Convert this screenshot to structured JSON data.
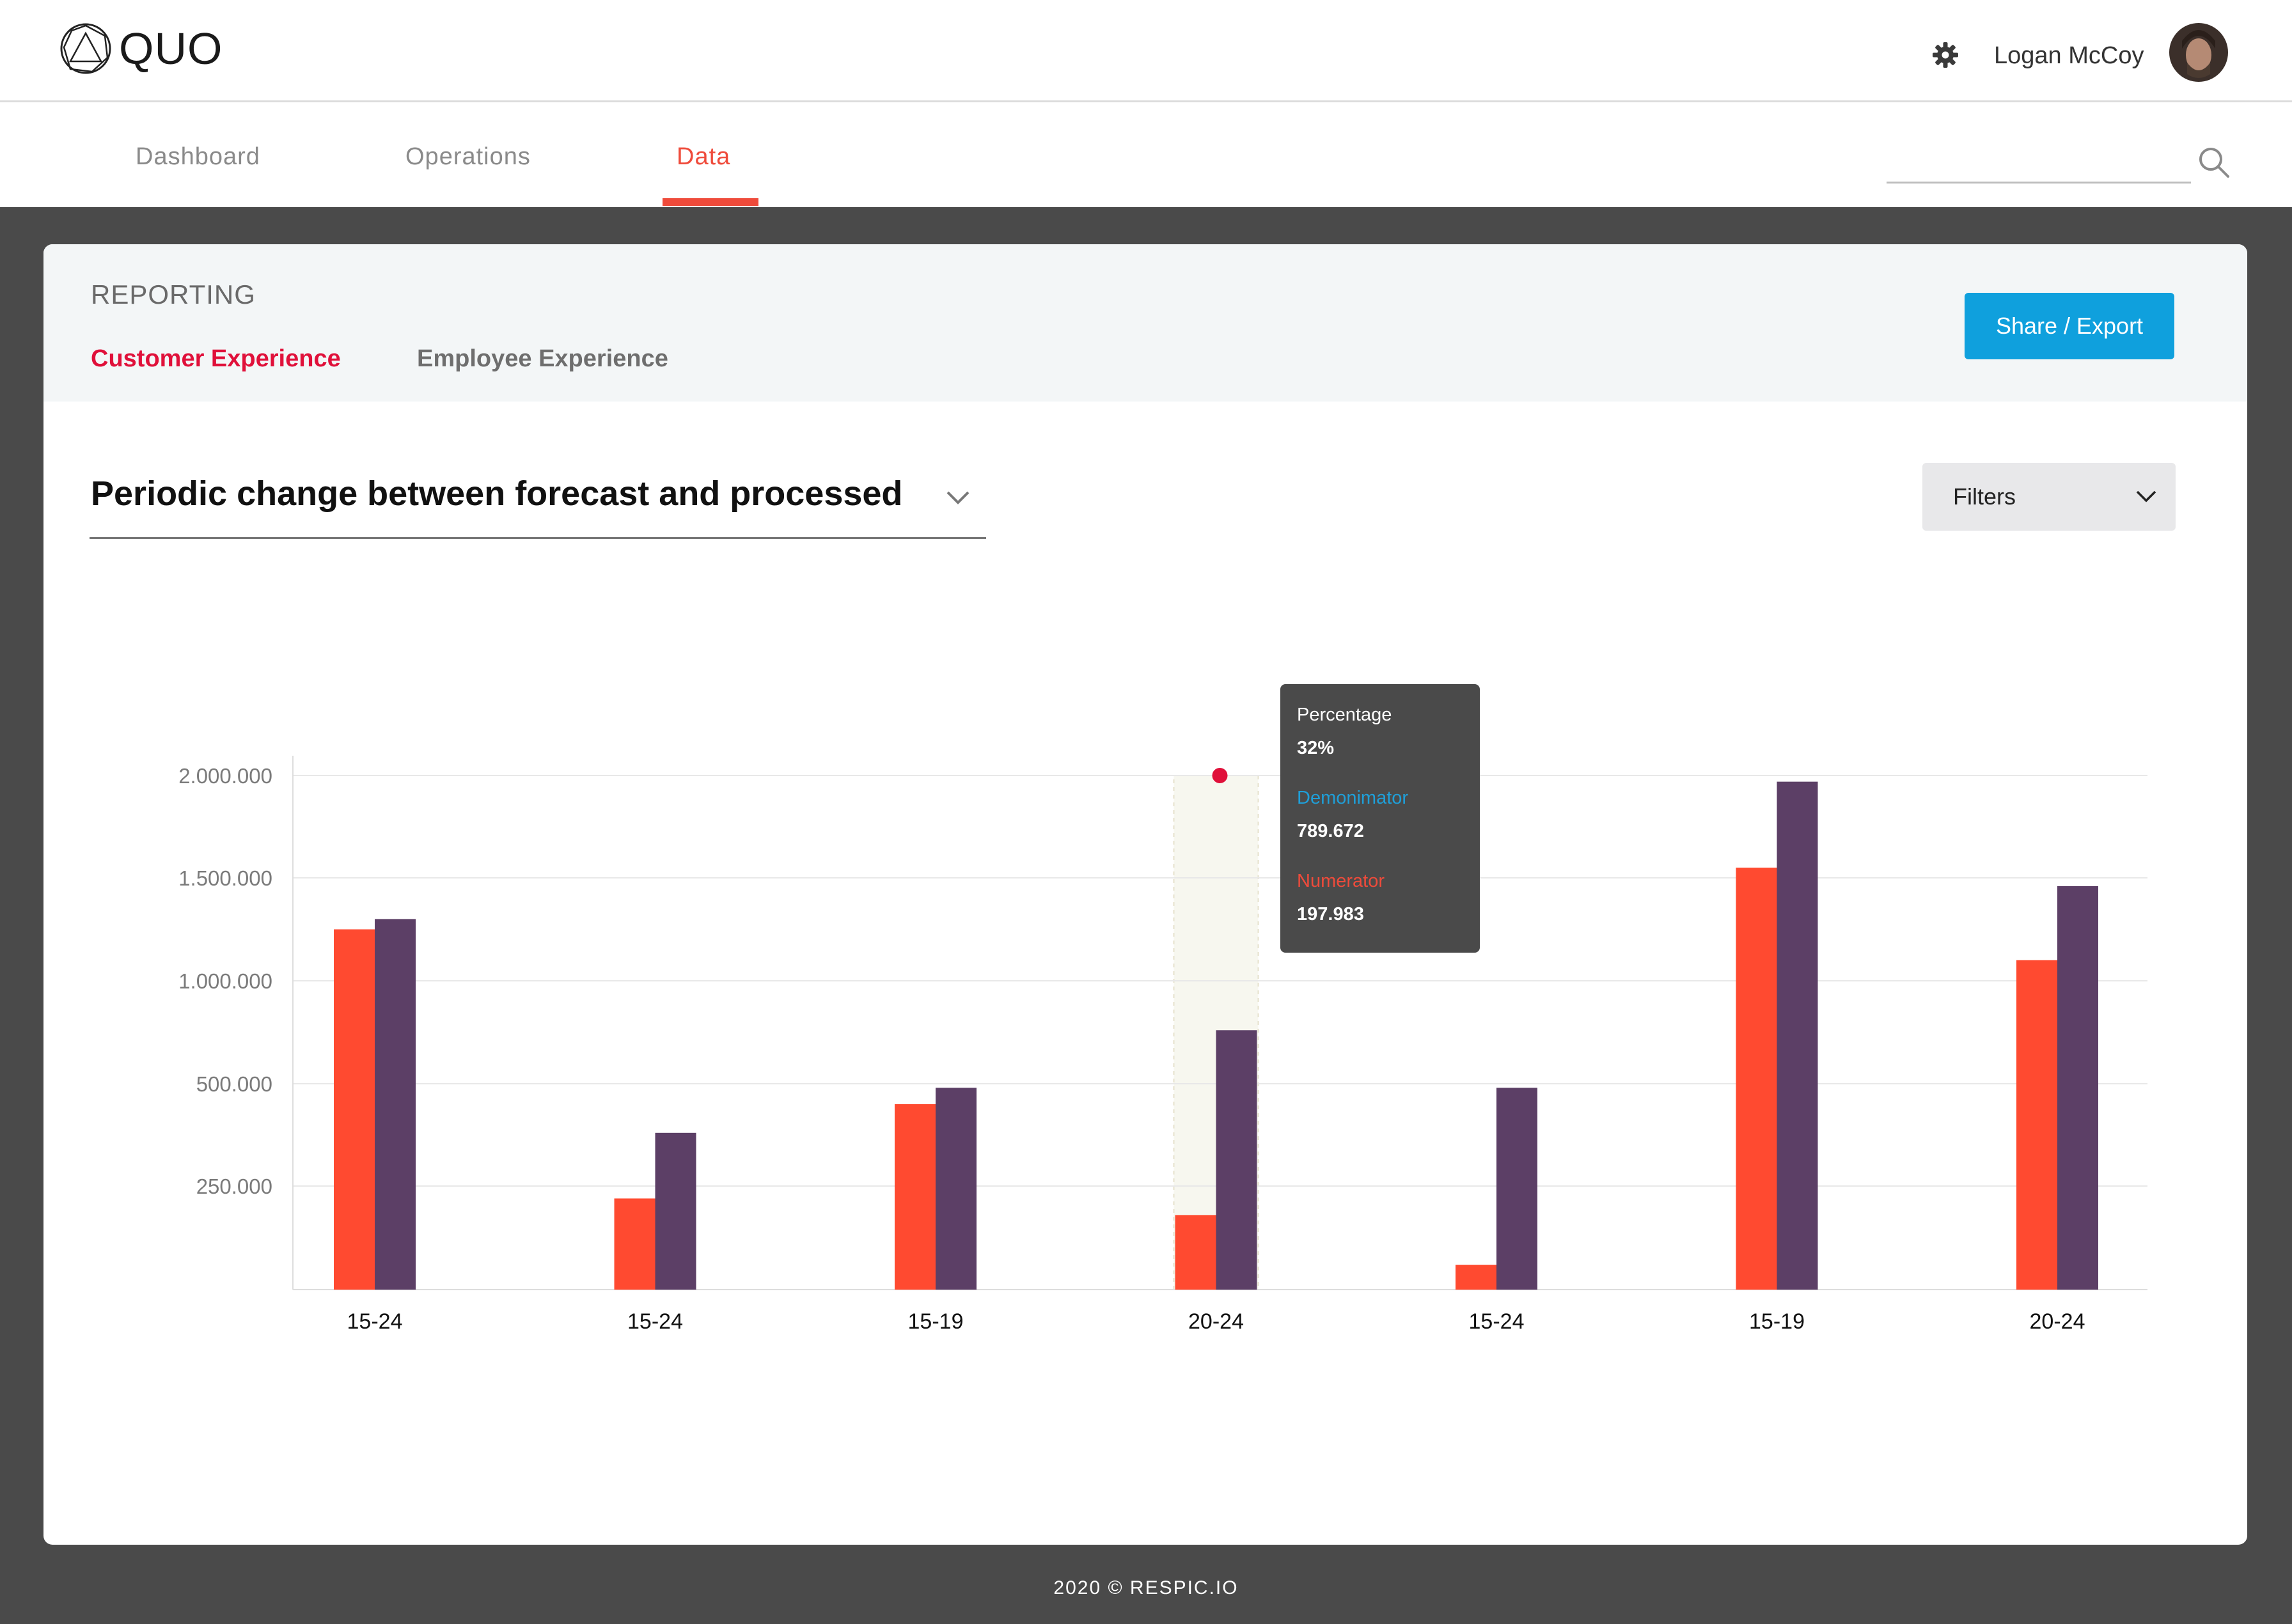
{
  "app": {
    "logo_text": "QUO",
    "user_name": "Logan McCoy"
  },
  "nav": {
    "tabs": [
      {
        "label": "Dashboard"
      },
      {
        "label": "Operations"
      },
      {
        "label": "Data"
      }
    ],
    "active_tab": "Data"
  },
  "report": {
    "section_title": "REPORTING",
    "subtabs": [
      {
        "label": "Customer Experience",
        "active": true
      },
      {
        "label": "Employee Experience",
        "active": false
      }
    ],
    "share_label": "Share / Export",
    "chart_title": "Periodic change between forecast and processed",
    "filters_label": "Filters"
  },
  "tooltip": {
    "percentage_label": "Percentage",
    "percentage_value": "32%",
    "denominator_label": "Demonimator",
    "denominator_value": "789.672",
    "numerator_label": "Numerator",
    "numerator_value": "197.983"
  },
  "footer": "2020 © RESPIC.IO",
  "colors": {
    "accent": "#ef4b3b",
    "numerator_bar": "#ff4a30",
    "denominator_bar": "#5c3f66",
    "share_button": "#0fa0dd",
    "highlight": "#f7f7ef"
  },
  "chart_data": {
    "type": "bar",
    "categories": [
      "15-24",
      "15-24",
      "15-19",
      "20-24",
      "15-24",
      "15-19",
      "20-24"
    ],
    "series": [
      {
        "values": [
          1250000,
          220000,
          450000,
          180000,
          60000,
          1550000,
          1100000
        ]
      },
      {
        "values": [
          1300000,
          380000,
          490000,
          760000,
          490000,
          1970000,
          1460000
        ]
      }
    ],
    "yticks": [
      "250.000",
      "500.000",
      "1.000.000",
      "1.500.000",
      "2.000.000"
    ],
    "highlight_index": 3,
    "marker_value": 2000000,
    "grid": true
  }
}
